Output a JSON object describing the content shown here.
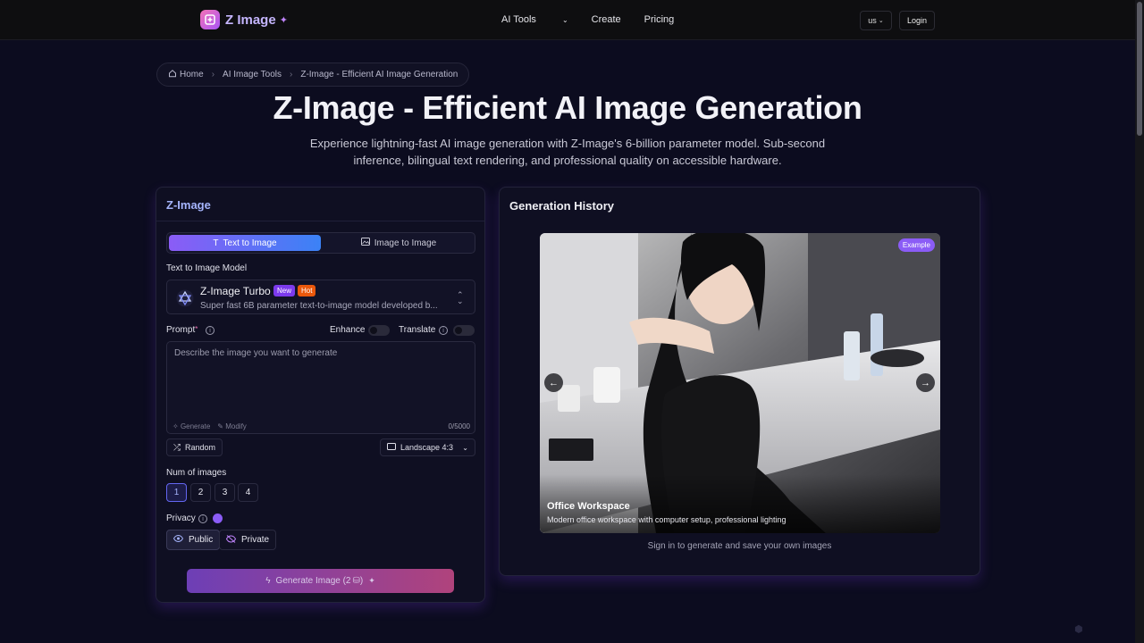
{
  "header": {
    "logo_text": "Z Image",
    "nav": [
      "AI Tools",
      "Create",
      "Pricing"
    ],
    "lang": "us",
    "login": "Login"
  },
  "breadcrumb": [
    "Home",
    "AI Image Tools",
    "Z-Image - Efficient AI Image Generation"
  ],
  "hero": {
    "title": "Z-Image - Efficient AI Image Generation",
    "subtitle": "Experience lightning-fast AI image generation with Z-Image's 6-billion parameter model. Sub-second inference, bilingual text rendering, and professional quality on accessible hardware."
  },
  "generator": {
    "title": "Z-Image",
    "tabs": [
      "Text to Image",
      "Image to Image"
    ],
    "model_label": "Text to Image Model",
    "model_name": "Z-Image Turbo",
    "badge_new": "New",
    "badge_hot": "Hot",
    "model_desc": "Super fast 6B parameter text-to-image model developed b...",
    "prompt_label": "Prompt",
    "required_mark": "*",
    "enhance_label": "Enhance",
    "translate_label": "Translate",
    "prompt_placeholder": "Describe the image you want to generate",
    "prompt_generate": "Generate",
    "prompt_modify": "Modify",
    "char_count": "0/5000",
    "random_label": "Random",
    "aspect_label": "Landscape 4:3",
    "num_label": "Num of images",
    "num_options": [
      "1",
      "2",
      "3",
      "4"
    ],
    "num_selected": "1",
    "privacy_label": "Privacy",
    "public_label": "Public",
    "private_label": "Private",
    "generate_button": "Generate Image (2"
  },
  "history": {
    "title": "Generation History",
    "badge": "Example",
    "photo_title": "Office Workspace",
    "photo_desc": "Modern office workspace with computer setup, professional lighting",
    "signin_note": "Sign in to generate and save your own images"
  },
  "colors": {
    "accent_purple": "#8b5cf6",
    "accent_blue": "#3b82f6",
    "badge_hot": "#ea580c",
    "background": "#0c0c1f"
  }
}
